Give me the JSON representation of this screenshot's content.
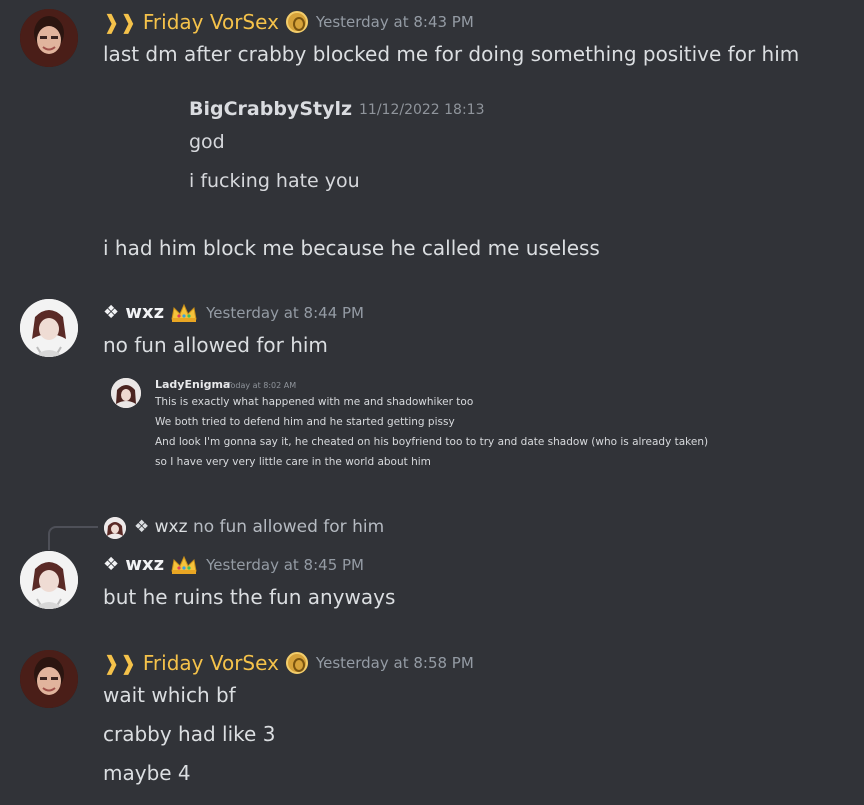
{
  "messages": [
    {
      "author": "❱❱ Friday VorSex",
      "timestamp": "Yesterday at 8:43 PM",
      "lines": [
        "last dm after crabby blocked me for doing something positive for him",
        "i had him block me because he called me useless"
      ],
      "embed": {
        "author": "BigCrabbyStylz",
        "timestamp": "11/12/2022 18:13",
        "lines": [
          "god",
          "i fucking hate you"
        ]
      }
    },
    {
      "author": "❖ wxz",
      "timestamp": "Yesterday at 8:44 PM",
      "lines": [
        "no fun allowed for him"
      ],
      "embed": {
        "author": "LadyEnigma",
        "timestamp": "Today at 8:02 AM",
        "lines": [
          "This is exactly what happened with me and shadowhiker too",
          "We both tried to defend him and he started getting pissy",
          "And look I'm gonna say it, he cheated on his boyfriend too to try and date shadow (who is already taken)",
          "so I have very very little care in the world about him"
        ]
      }
    },
    {
      "reply": {
        "author": "❖ wxz",
        "text": "no fun allowed for him"
      },
      "author": "❖ wxz",
      "timestamp": "Yesterday at 8:45 PM",
      "lines": [
        "but he ruins the fun anyways"
      ]
    },
    {
      "author": "❱❱ Friday VorSex",
      "timestamp": "Yesterday at 8:58 PM",
      "lines": [
        "wait which bf",
        "crabby had like 3",
        "maybe 4"
      ]
    }
  ],
  "colors": {
    "background": "#313338",
    "friday_name": "#f5c24a",
    "timestamp": "#949ba4",
    "text": "#dbdee1"
  },
  "icons": {
    "friday_badge": "gold-coin-badge-icon",
    "wxz_badge": "crown-icon"
  }
}
